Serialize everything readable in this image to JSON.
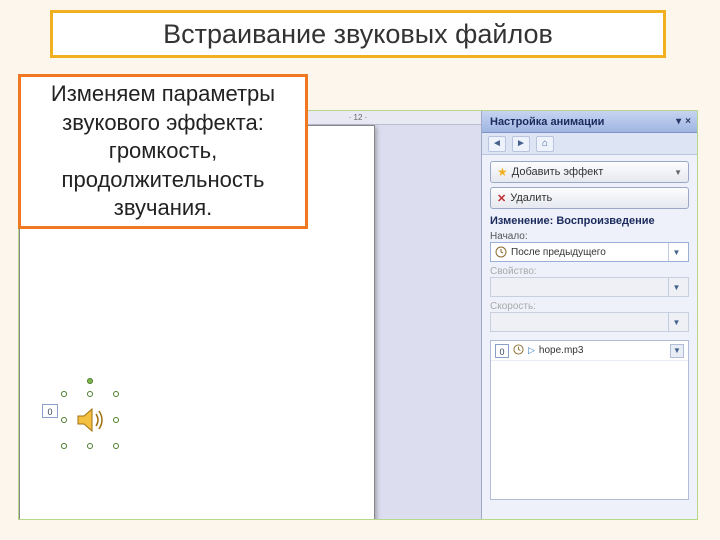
{
  "title": "Встраивание звуковых файлов",
  "caption": "Изменяем параметры звукового эффекта: громкость, продолжительность звучания.",
  "ruler_mark": "· 12 ·",
  "anim_tag": "0",
  "pane": {
    "title": "Настройка анимации",
    "add_effect": "Добавить эффект",
    "remove": "Удалить",
    "change_label": "Изменение: Воспроизведение",
    "start_label": "Начало:",
    "start_value": "После предыдущего",
    "property_label": "Свойство:",
    "speed_label": "Скорость:",
    "effect": {
      "order": "0",
      "name": "hope.mp3"
    }
  }
}
